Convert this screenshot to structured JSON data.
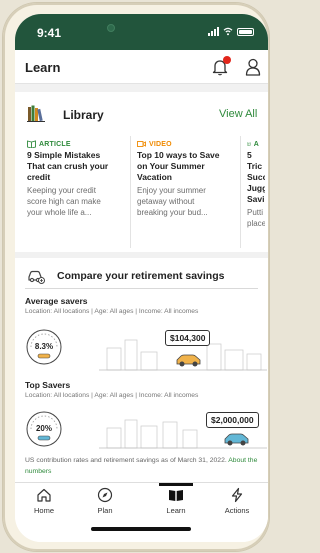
{
  "status_bar": {
    "time": "9:41"
  },
  "header": {
    "title": "Learn"
  },
  "library": {
    "title": "Library",
    "view_all": "View All",
    "articles": [
      {
        "tag": "ARTICLE",
        "title_lines": [
          "9 Simple Mistakes",
          "That can crush your",
          "credit"
        ],
        "desc_lines": [
          "Keeping your credit",
          "score high can make",
          "your whole life a..."
        ]
      },
      {
        "tag": "VIDEO",
        "title_lines": [
          "Top 10 ways to Save",
          "on Your Summer",
          "Vacation"
        ],
        "desc_lines": [
          "Enjoy your summer",
          "getaway without",
          "breaking your bud..."
        ]
      },
      {
        "tag": "A",
        "title_lines": [
          "5 Tric",
          "Succ",
          "Jugg",
          "Savi"
        ],
        "desc_lines": [
          "Putti",
          "place"
        ]
      }
    ]
  },
  "retirement": {
    "title": "Compare your retirement savings",
    "average": {
      "title": "Average savers",
      "meta": "Location: All locations | Age: All ages | Income: All incomes",
      "rate": "8.3%",
      "amount": "$104,300"
    },
    "top": {
      "title": "Top Savers",
      "meta": "Location: All locations | Age: All ages | Income: All incomes",
      "rate": "20%",
      "amount": "$2,000,000"
    },
    "footnote": "US contribution rates and retirement savings as of March 31, 2022.",
    "footnote_link": "About the numbers"
  },
  "tabs": [
    {
      "label": "Home",
      "icon": "home-icon"
    },
    {
      "label": "Plan",
      "icon": "compass-icon"
    },
    {
      "label": "Learn",
      "icon": "book-icon"
    },
    {
      "label": "Actions",
      "icon": "lightning-icon"
    }
  ],
  "colors": {
    "status_bar": "#22553c",
    "accent_green": "#2f8a3c",
    "video_orange": "#f08a00",
    "notification_red": "#e2261b",
    "car_orange": "#f0b24a",
    "car_blue": "#62b7d6"
  }
}
